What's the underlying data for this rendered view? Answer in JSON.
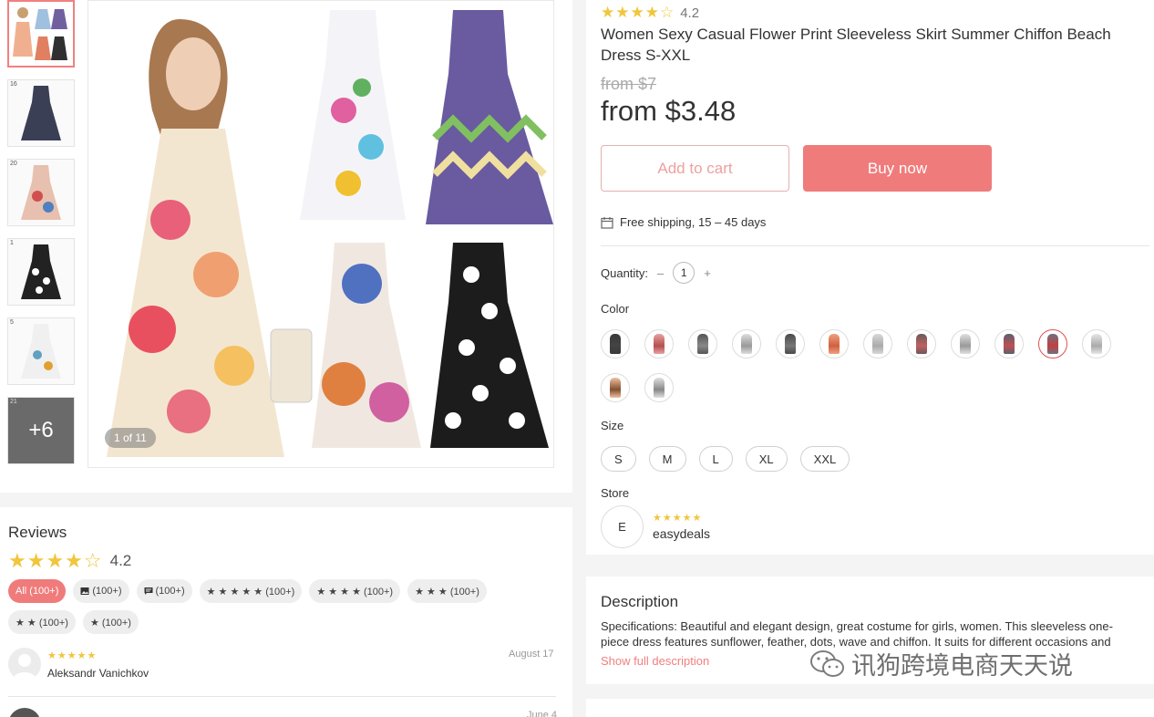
{
  "product": {
    "rating": "4.2",
    "title": "Women Sexy Casual Flower Print Sleeveless Skirt Summer Chiffon Beach Dress S-XXL",
    "old_price": "from $7",
    "price": "from $3.48",
    "add_to_cart": "Add to cart",
    "buy_now": "Buy now",
    "shipping": "Free shipping, 15 – 45 days",
    "quantity_label": "Quantity:",
    "quantity_minus": "–",
    "quantity_value": "1",
    "quantity_plus": "+",
    "color_label": "Color",
    "size_label": "Size",
    "sizes": [
      "S",
      "M",
      "L",
      "XL",
      "XXL"
    ],
    "store_label": "Store",
    "store_initial": "E",
    "store_name": "easydeals",
    "store_stars": "★★★★★"
  },
  "gallery": {
    "counter": "1 of 11",
    "more": "+6",
    "thumb_indices": [
      "",
      "16",
      "20",
      "1",
      "5",
      "21"
    ]
  },
  "colors": [
    {
      "dress": "#3a3a3a",
      "pattern": "#444"
    },
    {
      "dress": "#e8a0a0",
      "pattern": "#b45050"
    },
    {
      "dress": "#555555",
      "pattern": "#888"
    },
    {
      "dress": "#dddddd",
      "pattern": "#999"
    },
    {
      "dress": "#4a4a4a",
      "pattern": "#777"
    },
    {
      "dress": "#f0a080",
      "pattern": "#d06040"
    },
    {
      "dress": "#d8d8d8",
      "pattern": "#aaa"
    },
    {
      "dress": "#6a5a5a",
      "pattern": "#c06060"
    },
    {
      "dress": "#e0e0e0",
      "pattern": "#999"
    },
    {
      "dress": "#5a6070",
      "pattern": "#c05050"
    },
    {
      "dress": "#707080",
      "pattern": "#c04040"
    },
    {
      "dress": "#e6e6e6",
      "pattern": "#aaa"
    },
    {
      "dress": "#f0c0a0",
      "pattern": "#805030"
    },
    {
      "dress": "#e0e0e0",
      "pattern": "#888"
    }
  ],
  "selected_color_index": 10,
  "description": {
    "title": "Description",
    "text": "Specifications: Beautiful and elegant design, great costume for girls, women. This sleeveless one-piece dress features sunflower, feather, dots, wave and chiffon. It suits for different occasions and",
    "link": "Show full description"
  },
  "reviews": {
    "title": "Reviews",
    "rating": "4.2",
    "filters": [
      {
        "label": "All (100+)",
        "icon": "",
        "active": true
      },
      {
        "label": "(100+)",
        "icon": "image-icon",
        "active": false
      },
      {
        "label": "(100+)",
        "icon": "comment-icon",
        "active": false
      },
      {
        "label": "★ ★ ★ ★ ★ (100+)",
        "icon": "",
        "active": false
      },
      {
        "label": "★ ★ ★ ★ (100+)",
        "icon": "",
        "active": false
      },
      {
        "label": "★ ★ ★ (100+)",
        "icon": "",
        "active": false
      },
      {
        "label": "★ ★ (100+)",
        "icon": "",
        "active": false
      },
      {
        "label": "★ (100+)",
        "icon": "",
        "active": false
      }
    ],
    "first": {
      "stars": "★★★★★",
      "name": "Aleksandr Vanichkov",
      "date": "August 17"
    },
    "second_date": "June 4"
  },
  "watermark": "讯狗跨境电商天天说",
  "colors_theme": {
    "accent": "#f07b7b",
    "star": "#f0c63c"
  }
}
